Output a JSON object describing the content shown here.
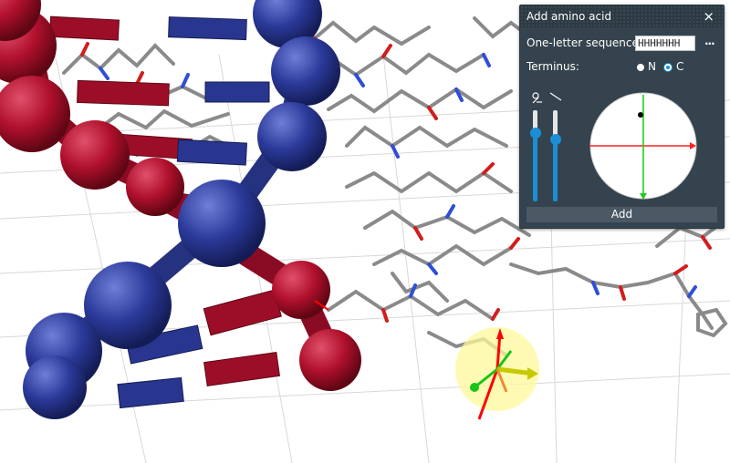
{
  "panel": {
    "title": "Add amino acid",
    "close_glyph": "×",
    "sequence_label": "One-letter sequence:",
    "sequence_value": "HHHHHHH",
    "more_glyph": "···",
    "terminus_label": "Terminus:",
    "terminus_options": [
      {
        "label": "N",
        "selected": false
      },
      {
        "label": "C",
        "selected": true
      }
    ],
    "slider_icons": [
      "phi-psi-icon",
      "line-angle-icon"
    ],
    "slider_levels": [
      0.75,
      0.68
    ],
    "add_label": "Add"
  },
  "colors": {
    "panel_bg": "#34434d",
    "accent": "#1a8fd6",
    "strand_red": "#b0102c",
    "strand_blue": "#2b3a9a"
  }
}
